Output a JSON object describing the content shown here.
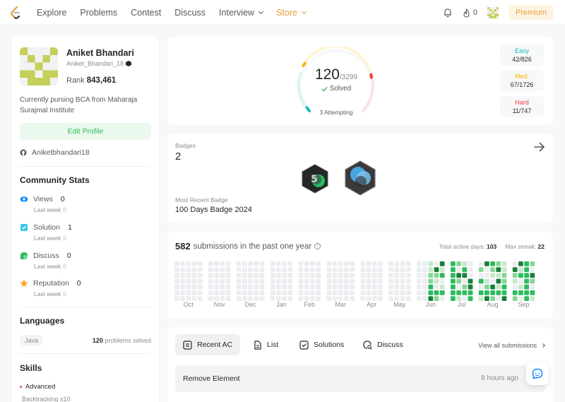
{
  "nav": {
    "items": [
      {
        "label": "Explore"
      },
      {
        "label": "Problems"
      },
      {
        "label": "Contest"
      },
      {
        "label": "Discuss"
      },
      {
        "label": "Interview"
      },
      {
        "label": "Store"
      }
    ],
    "fire_count": "0",
    "premium_label": "Premium"
  },
  "profile": {
    "name": "Aniket Bhandari",
    "username": "Aniket_Bhandari_18",
    "rank_label": "Rank",
    "rank_value": "843,461",
    "bio": "Currently pursing BCA from Maharaja Surajmal Institute",
    "edit_label": "Edit Profile",
    "github": "Aniketbhandari18"
  },
  "community": {
    "title": "Community Stats",
    "stats": [
      {
        "label": "Views",
        "value": "0",
        "sub": "Last week",
        "delta": "0",
        "icon": "eye-icon",
        "color": "#1a90ff"
      },
      {
        "label": "Solution",
        "value": "1",
        "sub": "Last week",
        "delta": "0",
        "icon": "solution-icon",
        "color": "#38c7e8"
      },
      {
        "label": "Discuss",
        "value": "0",
        "sub": "Last week",
        "delta": "0",
        "icon": "discuss-icon",
        "color": "#2cbb5d"
      },
      {
        "label": "Reputation",
        "value": "0",
        "sub": "Last week",
        "delta": "0",
        "icon": "star-icon",
        "color": "#ffa116"
      }
    ]
  },
  "languages": {
    "title": "Languages",
    "items": [
      {
        "name": "Java",
        "count": "120",
        "suffix": "problems solved"
      }
    ]
  },
  "skills": {
    "title": "Skills",
    "level": "Advanced",
    "first_item": "Backtracking  x10"
  },
  "solved": {
    "count": "120",
    "total": "/3299",
    "label": "Solved",
    "attempting": "3 Attempting",
    "progress": 0.0364,
    "difficulty": [
      {
        "label": "Easy",
        "value": "42/826",
        "color": "#1cbaba"
      },
      {
        "label": "Med.",
        "value": "67/1726",
        "color": "#ffb700"
      },
      {
        "label": "Hard",
        "value": "11/747",
        "color": "#f63737"
      }
    ]
  },
  "badges": {
    "label": "Badges",
    "count": "2",
    "recent_label": "Most Recent Badge",
    "recent_name": "100 Days Badge 2024"
  },
  "submissions": {
    "count": "582",
    "text": "submissions in the past one year",
    "active_label": "Total active days:",
    "active_value": "103",
    "streak_label": "Max streak:",
    "streak_value": "22",
    "months": [
      "Oct",
      "Nov",
      "Dec",
      "Jan",
      "Feb",
      "Mar",
      "Apr",
      "May",
      "Jun",
      "Jul",
      "Aug",
      "Sep"
    ]
  },
  "recent": {
    "tabs": [
      {
        "label": "Recent AC",
        "icon": "recent-ac-icon"
      },
      {
        "label": "List",
        "icon": "list-icon"
      },
      {
        "label": "Solutions",
        "icon": "solutions-icon"
      },
      {
        "label": "Discuss",
        "icon": "discuss-search-icon"
      }
    ],
    "view_all": "View all submissions",
    "items": [
      {
        "title": "Remove Element",
        "time": "8 hours ago"
      }
    ]
  }
}
